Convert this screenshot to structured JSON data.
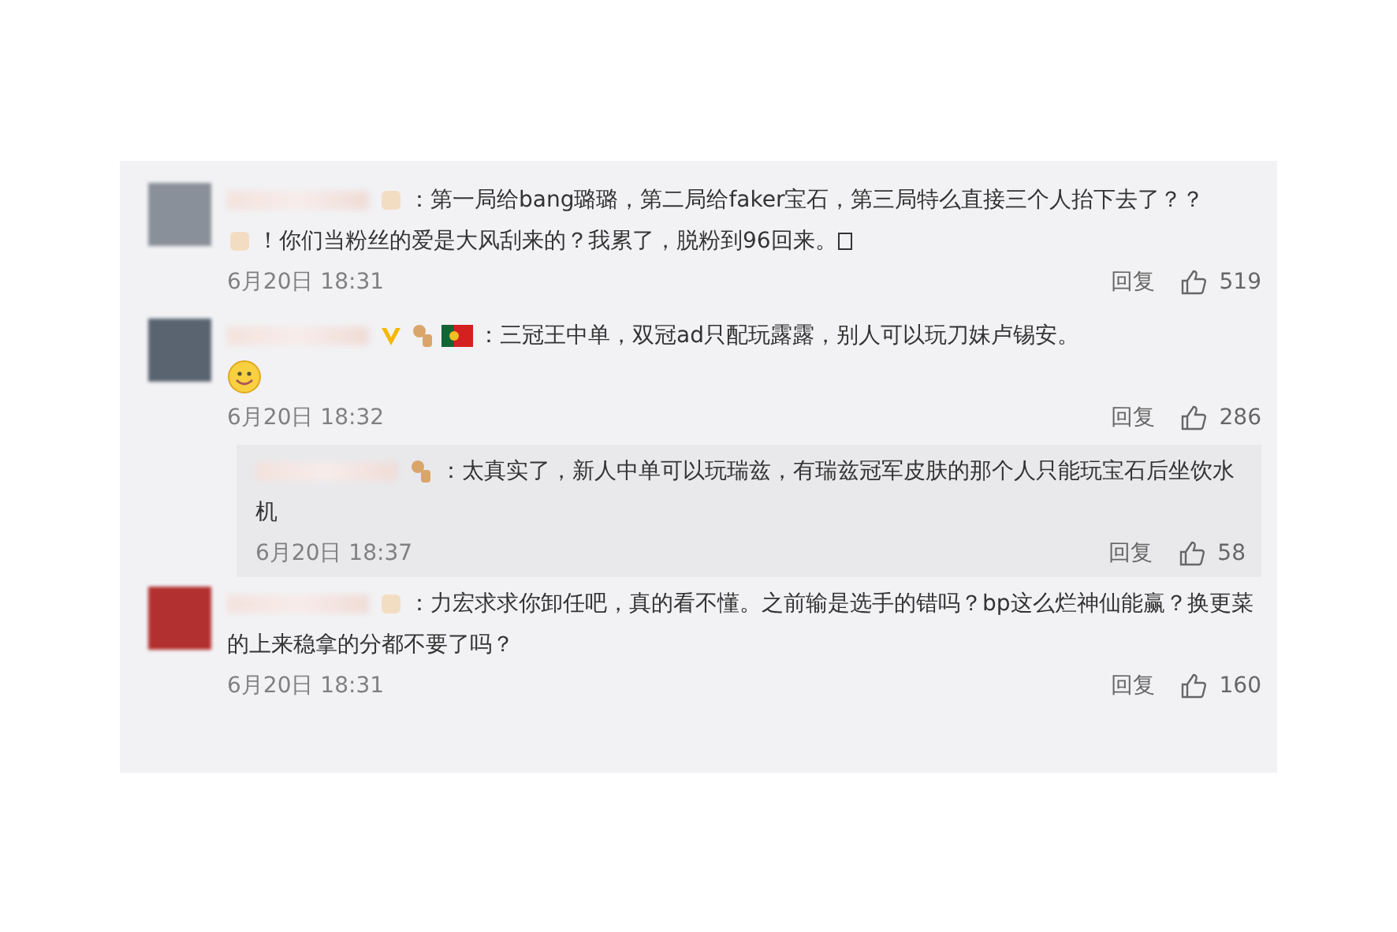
{
  "comments": [
    {
      "kind": "comment",
      "badges": [
        {
          "kind": "blur"
        }
      ],
      "text": "：第一局给bang璐璐，第二局给faker宝石，第三局特么直接三个人抬下去了？？",
      "continuation": "！你们当粉丝的爱是大风刮来的？我累了，脱粉到96回来。",
      "trailing_box": true,
      "emoji": false,
      "date": "6月20日 18:31",
      "reply": "回复",
      "likes": "519"
    },
    {
      "kind": "comment",
      "badges": [
        {
          "kind": "vip"
        },
        {
          "kind": "monkey"
        },
        {
          "kind": "flag"
        }
      ],
      "text": "：三冠王中单，双冠ad只配玩露露，别人可以玩刀妹卢锡安。",
      "trailing_box": false,
      "emoji": true,
      "date": "6月20日 18:32",
      "reply": "回复",
      "likes": "286"
    },
    {
      "kind": "reply",
      "badges": [
        {
          "kind": "monkey"
        }
      ],
      "text": "：太真实了，新人中单可以玩瑞兹，有瑞兹冠军皮肤的那个人只能玩宝石后坐饮水机",
      "trailing_box": false,
      "emoji": false,
      "date": "6月20日 18:37",
      "reply": "回复",
      "likes": "58"
    },
    {
      "kind": "comment",
      "badges": [
        {
          "kind": "blur"
        }
      ],
      "text": "：力宏求求你卸任吧，真的看不懂。之前输是选手的错吗？bp这么烂神仙能赢？换更菜的上来稳拿的分都不要了吗？",
      "trailing_box": false,
      "emoji": false,
      "date": "6月20日 18:31",
      "reply": "回复",
      "likes": "160"
    }
  ]
}
